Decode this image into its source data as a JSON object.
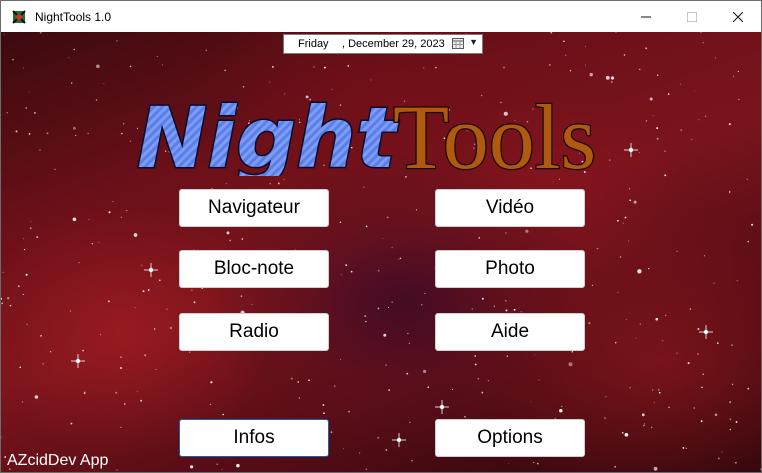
{
  "window": {
    "title": "NightTools 1.0"
  },
  "datepicker": {
    "day": "Friday",
    "date": ", December 29, 2023"
  },
  "logo": {
    "word1": "Night",
    "word2": "Tools"
  },
  "buttons": {
    "navigateur": "Navigateur",
    "video": "Vidéo",
    "blocnote": "Bloc-note",
    "photo": "Photo",
    "radio": "Radio",
    "aide": "Aide",
    "infos": "Infos",
    "options": "Options"
  },
  "footer": {
    "text": "AZcidDev App"
  },
  "colors": {
    "night_blue": "#5b7fe8",
    "tools_brown": "#b05a10"
  }
}
